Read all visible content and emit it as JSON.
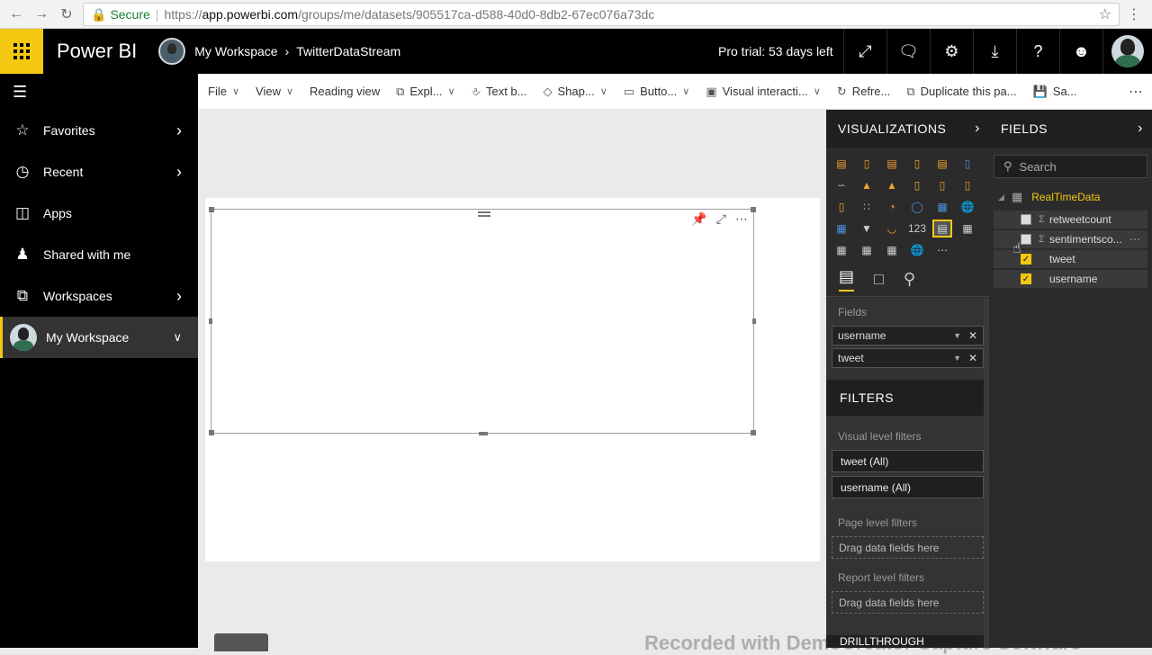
{
  "browser": {
    "secure_label": "Secure",
    "url_scheme": "https://",
    "url_host": "app.powerbi.com",
    "url_path": "/groups/me/datasets/905517ca-d588-40d0-8db2-67ec076a73dc"
  },
  "topbar": {
    "brand": "Power BI",
    "workspace": "My Workspace",
    "dataset": "TwitterDataStream",
    "trial": "Pro trial: 53 days left"
  },
  "leftnav": {
    "items": [
      {
        "label": "Favorites",
        "icon": "star-icon"
      },
      {
        "label": "Recent",
        "icon": "clock-icon"
      },
      {
        "label": "Apps",
        "icon": "apps-icon"
      },
      {
        "label": "Shared with me",
        "icon": "person-share-icon"
      },
      {
        "label": "Workspaces",
        "icon": "workspaces-icon"
      },
      {
        "label": "My Workspace",
        "icon": "avatar"
      }
    ]
  },
  "cmdbar": {
    "file": "File",
    "view": "View",
    "reading_view": "Reading view",
    "explore": "Expl...",
    "textbox": "Text b...",
    "shapes": "Shap...",
    "buttons": "Butto...",
    "visual_interactions": "Visual interacti...",
    "refresh": "Refre...",
    "duplicate": "Duplicate this pa...",
    "save": "Sa..."
  },
  "viz_pane": {
    "title": "VISUALIZATIONS",
    "fields_label": "Fields",
    "fields": [
      "username",
      "tweet"
    ]
  },
  "filters": {
    "title": "FILTERS",
    "visual_level": "Visual level filters",
    "chips": [
      "tweet  (All)",
      "username  (All)"
    ],
    "page_level": "Page level filters",
    "report_level": "Report level filters",
    "drop_hint": "Drag data fields here",
    "drillthrough": "DRILLTHROUGH"
  },
  "fields_pane": {
    "title": "FIELDS",
    "search_placeholder": "Search",
    "table": "RealTimeData",
    "fields": [
      {
        "name": "retweetcount",
        "checked": false,
        "numeric": true
      },
      {
        "name": "sentimentsco...",
        "checked": false,
        "numeric": true
      },
      {
        "name": "tweet",
        "checked": true,
        "numeric": false
      },
      {
        "name": "username",
        "checked": true,
        "numeric": false
      }
    ]
  },
  "watermark": "Recorded with DemoCreator Capture Software"
}
